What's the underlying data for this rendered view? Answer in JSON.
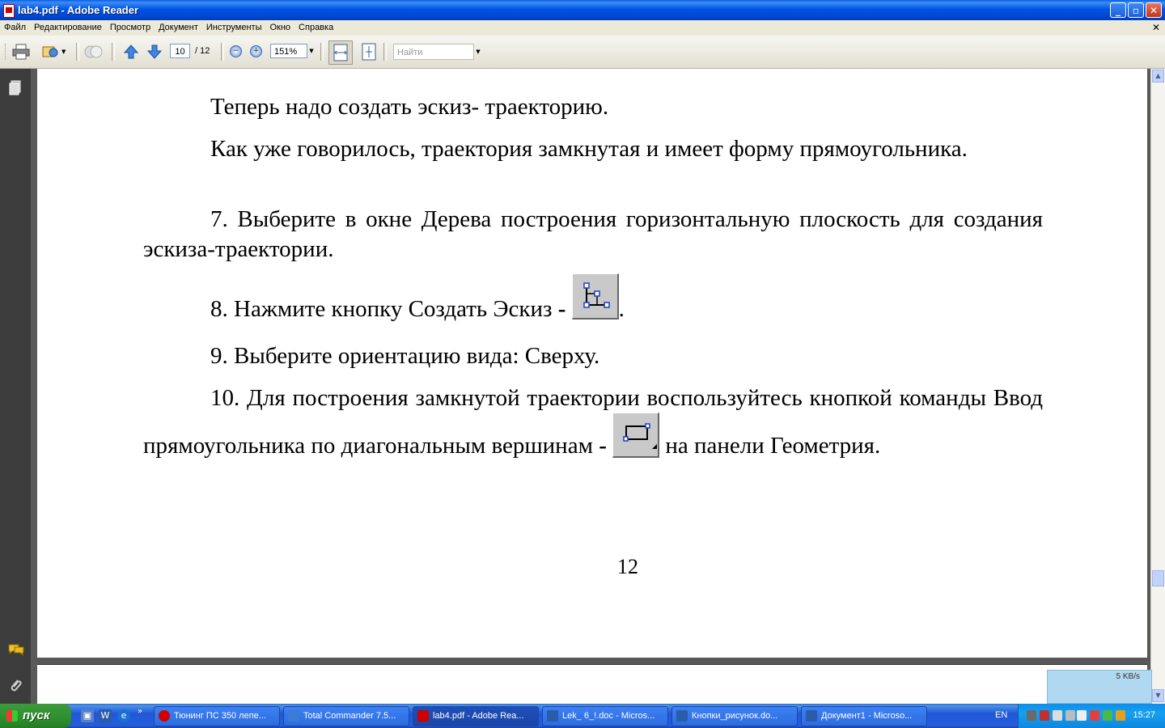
{
  "window": {
    "title": "lab4.pdf - Adobe Reader",
    "controls": {
      "minimize": "_",
      "maximize": "▫",
      "close": "✕"
    }
  },
  "menu": {
    "items": [
      "Файл",
      "Редактирование",
      "Просмотр",
      "Документ",
      "Инструменты",
      "Окно",
      "Справка"
    ],
    "close": "✕"
  },
  "toolbar": {
    "current_page": "10",
    "total_pages": "/ 12",
    "zoom": "151%",
    "find_placeholder": "Найти"
  },
  "document": {
    "paragraphs": [
      "Теперь надо создать эскиз- траекторию.",
      "Как уже говорилось, траектория замкнутая и имеет форму прямоугольника.",
      "7. Выберите в окне Дерева построения горизонтальную плоскость для создания эскиза-траектории."
    ],
    "step8_text": "8. Нажмите кнопку Создать Эскиз",
    "step8_dash": "-",
    "step8_end": ".",
    "step9": "9. Выберите ориентацию вида: Сверху.",
    "step10_before": "10. Для построения замкнутой траектории воспользуйтесь кнопкой команды Ввод прямоугольника по диагональным вершинам",
    "step10_dash": "-",
    "step10_after": "на панели Геометрия.",
    "page_number": "12"
  },
  "net_widget": {
    "rate": "5 KB/s"
  },
  "taskbar": {
    "start": "пуск",
    "tasks": [
      {
        "label": "Тюнинг ПС 350 лепе...",
        "icon_color": "#d40000"
      },
      {
        "label": "Total Commander 7.5...",
        "icon_color": "#3a7bd5"
      },
      {
        "label": "lab4.pdf - Adobe Rea...",
        "icon_color": "#cc0000"
      },
      {
        "label": "Lek_ 6_!.doc - Micros...",
        "icon_color": "#2a5caa"
      },
      {
        "label": "Кнопки_рисунок.do...",
        "icon_color": "#2a5caa"
      },
      {
        "label": "Документ1 - Microso...",
        "icon_color": "#2a5caa"
      }
    ],
    "active_task": 2,
    "lang": "EN",
    "clock": "15:27"
  },
  "colors": {
    "titlebar": "#0055e5",
    "taskbar": "#245edb",
    "start_button": "#2f8f2f",
    "document_bg": "#585858",
    "page_bg": "#ffffff"
  }
}
